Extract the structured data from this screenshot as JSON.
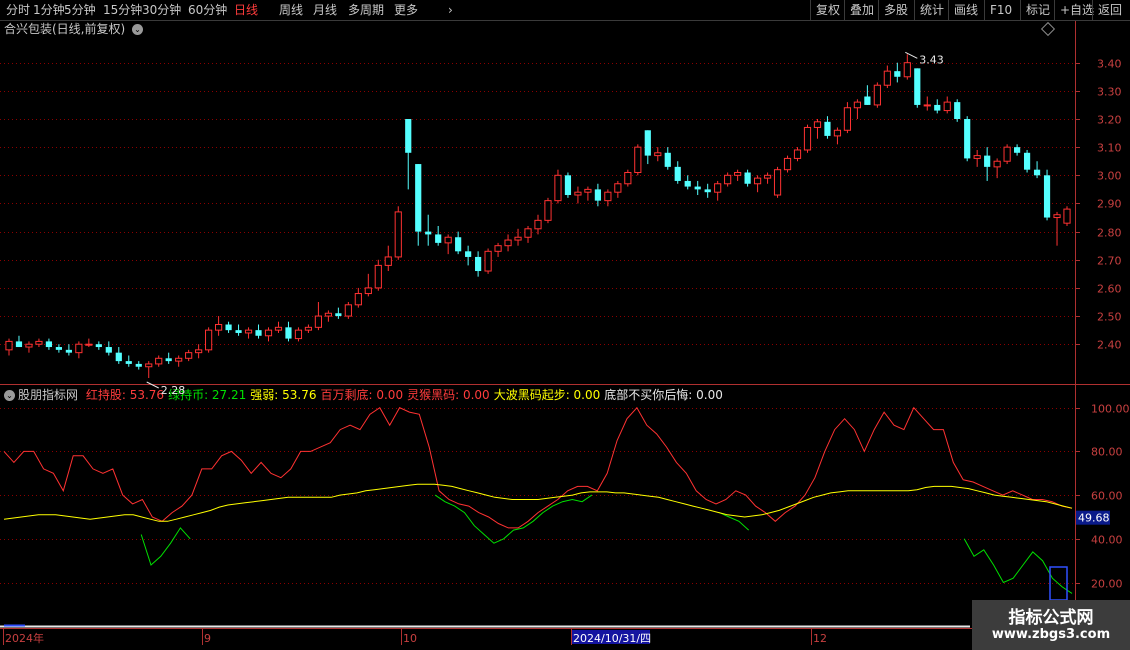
{
  "toolbar": {
    "periods": [
      "分时",
      "1分钟",
      "5分钟",
      "15分钟",
      "30分钟",
      "60分钟",
      "日线",
      "周线",
      "月线",
      "多周期",
      "更多"
    ],
    "active_period": "日线",
    "right_buttons": [
      "复权",
      "叠加",
      "多股",
      "统计",
      "画线",
      "F10",
      "标记",
      "+自选",
      "返回"
    ]
  },
  "main_chart": {
    "title": "合兴包装(日线,前复权)",
    "high_marker": "3.43",
    "low_marker": "2.28"
  },
  "indicator": {
    "name": "股朋指标网",
    "items": [
      {
        "label": "红持股:",
        "value": "53.76",
        "color": "#ff3c3c"
      },
      {
        "label": "绿持币:",
        "value": "27.21",
        "color": "#00e000"
      },
      {
        "label": "强弱:",
        "value": "53.76",
        "color": "#ffff00"
      },
      {
        "label": "百万剩底:",
        "value": "0.00",
        "color": "#ff3c3c"
      },
      {
        "label": "灵猴黑码:",
        "value": "0.00",
        "color": "#ff3c3c"
      },
      {
        "label": "大波黑码起步:",
        "value": "0.00",
        "color": "#ffff00"
      },
      {
        "label": "底部不买你后悔:",
        "value": "0.00",
        "color": "#e8e8e8"
      }
    ],
    "current_value_tag": "49.68"
  },
  "bottom_axis": {
    "labels": [
      "2024年",
      "9",
      "10",
      "2024/10/31/四",
      "12"
    ]
  },
  "watermark": {
    "line1": "指标公式网",
    "line2": "www.zbgs3.com"
  },
  "colors": {
    "up": "#ff3232",
    "down": "#54ffff",
    "grid": "#8b0000",
    "strength": "#ffff00",
    "hold": "#ff3232",
    "cash": "#00e000"
  },
  "chart_data": [
    {
      "type": "candlestick",
      "title": "合兴包装(日线,前复权)",
      "y_ticks": [
        2.4,
        2.5,
        2.6,
        2.7,
        2.8,
        2.9,
        3.0,
        3.1,
        3.2,
        3.3,
        3.4
      ],
      "ylim": [
        2.28,
        3.47
      ],
      "candles": [
        [
          2.38,
          2.42,
          2.36,
          2.41
        ],
        [
          2.41,
          2.43,
          2.39,
          2.39
        ],
        [
          2.39,
          2.41,
          2.37,
          2.4
        ],
        [
          2.4,
          2.42,
          2.39,
          2.41
        ],
        [
          2.41,
          2.42,
          2.38,
          2.39
        ],
        [
          2.39,
          2.4,
          2.37,
          2.38
        ],
        [
          2.38,
          2.4,
          2.36,
          2.37
        ],
        [
          2.37,
          2.41,
          2.35,
          2.4
        ],
        [
          2.4,
          2.42,
          2.39,
          2.4
        ],
        [
          2.4,
          2.41,
          2.38,
          2.39
        ],
        [
          2.39,
          2.41,
          2.36,
          2.37
        ],
        [
          2.37,
          2.39,
          2.33,
          2.34
        ],
        [
          2.34,
          2.36,
          2.32,
          2.33
        ],
        [
          2.33,
          2.34,
          2.31,
          2.32
        ],
        [
          2.32,
          2.34,
          2.28,
          2.33
        ],
        [
          2.33,
          2.36,
          2.32,
          2.35
        ],
        [
          2.35,
          2.37,
          2.33,
          2.34
        ],
        [
          2.34,
          2.36,
          2.32,
          2.35
        ],
        [
          2.35,
          2.38,
          2.34,
          2.37
        ],
        [
          2.37,
          2.4,
          2.35,
          2.38
        ],
        [
          2.38,
          2.46,
          2.37,
          2.45
        ],
        [
          2.45,
          2.5,
          2.43,
          2.47
        ],
        [
          2.47,
          2.48,
          2.44,
          2.45
        ],
        [
          2.45,
          2.47,
          2.43,
          2.44
        ],
        [
          2.44,
          2.46,
          2.42,
          2.45
        ],
        [
          2.45,
          2.47,
          2.42,
          2.43
        ],
        [
          2.43,
          2.46,
          2.41,
          2.45
        ],
        [
          2.45,
          2.48,
          2.44,
          2.46
        ],
        [
          2.46,
          2.48,
          2.41,
          2.42
        ],
        [
          2.42,
          2.46,
          2.41,
          2.45
        ],
        [
          2.45,
          2.47,
          2.44,
          2.46
        ],
        [
          2.46,
          2.55,
          2.45,
          2.5
        ],
        [
          2.5,
          2.52,
          2.48,
          2.51
        ],
        [
          2.51,
          2.53,
          2.49,
          2.5
        ],
        [
          2.5,
          2.55,
          2.49,
          2.54
        ],
        [
          2.54,
          2.6,
          2.53,
          2.58
        ],
        [
          2.58,
          2.65,
          2.57,
          2.6
        ],
        [
          2.6,
          2.7,
          2.59,
          2.68
        ],
        [
          2.68,
          2.75,
          2.66,
          2.71
        ],
        [
          2.71,
          2.89,
          2.7,
          2.87
        ],
        [
          3.2,
          3.2,
          2.95,
          3.08
        ],
        [
          3.04,
          3.04,
          2.75,
          2.8
        ],
        [
          2.8,
          2.86,
          2.75,
          2.79
        ],
        [
          2.79,
          2.82,
          2.75,
          2.76
        ],
        [
          2.76,
          2.79,
          2.72,
          2.78
        ],
        [
          2.78,
          2.8,
          2.72,
          2.73
        ],
        [
          2.73,
          2.75,
          2.68,
          2.71
        ],
        [
          2.71,
          2.73,
          2.64,
          2.66
        ],
        [
          2.66,
          2.74,
          2.65,
          2.73
        ],
        [
          2.73,
          2.76,
          2.71,
          2.75
        ],
        [
          2.75,
          2.79,
          2.73,
          2.77
        ],
        [
          2.77,
          2.81,
          2.75,
          2.78
        ],
        [
          2.78,
          2.82,
          2.76,
          2.81
        ],
        [
          2.81,
          2.86,
          2.79,
          2.84
        ],
        [
          2.84,
          2.92,
          2.83,
          2.91
        ],
        [
          2.91,
          3.02,
          2.9,
          3.0
        ],
        [
          3.0,
          3.01,
          2.92,
          2.93
        ],
        [
          2.93,
          2.96,
          2.9,
          2.94
        ],
        [
          2.94,
          2.96,
          2.91,
          2.95
        ],
        [
          2.95,
          2.97,
          2.89,
          2.91
        ],
        [
          2.91,
          2.95,
          2.89,
          2.94
        ],
        [
          2.94,
          2.98,
          2.92,
          2.97
        ],
        [
          2.97,
          3.02,
          2.96,
          3.01
        ],
        [
          3.01,
          3.11,
          3.0,
          3.1
        ],
        [
          3.16,
          3.16,
          3.04,
          3.07
        ],
        [
          3.07,
          3.1,
          3.05,
          3.08
        ],
        [
          3.08,
          3.1,
          3.02,
          3.03
        ],
        [
          3.03,
          3.05,
          2.97,
          2.98
        ],
        [
          2.98,
          3.0,
          2.95,
          2.96
        ],
        [
          2.96,
          2.98,
          2.93,
          2.95
        ],
        [
          2.95,
          2.97,
          2.92,
          2.94
        ],
        [
          2.94,
          2.98,
          2.91,
          2.97
        ],
        [
          2.97,
          3.01,
          2.96,
          3.0
        ],
        [
          3.0,
          3.02,
          2.98,
          3.01
        ],
        [
          3.01,
          3.02,
          2.96,
          2.97
        ],
        [
          2.97,
          3.0,
          2.94,
          2.99
        ],
        [
          2.99,
          3.01,
          2.97,
          3.0
        ],
        [
          2.93,
          3.03,
          2.92,
          3.02
        ],
        [
          3.02,
          3.07,
          3.01,
          3.06
        ],
        [
          3.06,
          3.1,
          3.05,
          3.09
        ],
        [
          3.09,
          3.18,
          3.08,
          3.17
        ],
        [
          3.17,
          3.2,
          3.13,
          3.19
        ],
        [
          3.19,
          3.21,
          3.13,
          3.14
        ],
        [
          3.14,
          3.17,
          3.11,
          3.16
        ],
        [
          3.16,
          3.26,
          3.15,
          3.24
        ],
        [
          3.24,
          3.27,
          3.2,
          3.26
        ],
        [
          3.28,
          3.32,
          3.25,
          3.25
        ],
        [
          3.25,
          3.33,
          3.24,
          3.32
        ],
        [
          3.32,
          3.39,
          3.31,
          3.37
        ],
        [
          3.37,
          3.4,
          3.33,
          3.35
        ],
        [
          3.35,
          3.43,
          3.34,
          3.4
        ],
        [
          3.38,
          3.38,
          3.24,
          3.25
        ],
        [
          3.25,
          3.28,
          3.23,
          3.25
        ],
        [
          3.25,
          3.27,
          3.22,
          3.23
        ],
        [
          3.23,
          3.28,
          3.22,
          3.26
        ],
        [
          3.26,
          3.27,
          3.19,
          3.2
        ],
        [
          3.2,
          3.21,
          3.05,
          3.06
        ],
        [
          3.06,
          3.09,
          3.03,
          3.07
        ],
        [
          3.07,
          3.1,
          2.98,
          3.03
        ],
        [
          3.03,
          3.06,
          2.99,
          3.05
        ],
        [
          3.05,
          3.11,
          3.04,
          3.1
        ],
        [
          3.1,
          3.11,
          3.07,
          3.08
        ],
        [
          3.08,
          3.09,
          3.01,
          3.02
        ],
        [
          3.02,
          3.05,
          2.99,
          3.0
        ],
        [
          3.0,
          3.02,
          2.84,
          2.85
        ],
        [
          2.85,
          2.87,
          2.75,
          2.86
        ],
        [
          2.83,
          2.89,
          2.82,
          2.88
        ]
      ]
    },
    {
      "type": "line",
      "title": "股朋指标网",
      "y_ticks": [
        20,
        40,
        60,
        80,
        100
      ],
      "ylim": [
        12,
        104
      ],
      "series": [
        {
          "name": "红持股",
          "color": "#ff3232",
          "values": [
            80,
            75,
            80,
            80,
            72,
            70,
            62,
            78,
            78,
            72,
            70,
            72,
            60,
            56,
            58,
            50,
            48,
            52,
            55,
            60,
            72,
            72,
            78,
            80,
            76,
            70,
            75,
            70,
            68,
            72,
            80,
            80,
            82,
            84,
            90,
            92,
            90,
            97,
            100,
            92,
            100,
            98,
            97,
            82,
            62,
            58,
            56,
            55,
            52,
            50,
            47,
            45,
            45,
            48,
            52,
            55,
            58,
            62,
            64,
            64,
            62,
            70,
            85,
            95,
            100,
            92,
            88,
            82,
            75,
            70,
            62,
            58,
            56,
            58,
            62,
            60,
            55,
            52,
            48,
            52,
            55,
            60,
            68,
            80,
            90,
            95,
            90,
            80,
            90,
            98,
            92,
            90,
            100,
            95,
            90,
            90,
            75,
            67,
            66,
            64,
            62,
            60,
            62,
            60,
            58,
            58,
            57,
            55,
            54
          ]
        },
        {
          "name": "绿持币",
          "color": "#00e000",
          "values": [
            null,
            null,
            null,
            null,
            null,
            null,
            null,
            null,
            null,
            null,
            null,
            null,
            null,
            null,
            42,
            28,
            32,
            38,
            45,
            40,
            null,
            null,
            null,
            null,
            null,
            null,
            null,
            null,
            null,
            null,
            null,
            null,
            null,
            null,
            null,
            null,
            null,
            null,
            null,
            null,
            null,
            null,
            null,
            null,
            60,
            57,
            55,
            52,
            46,
            42,
            38,
            40,
            44,
            45,
            48,
            52,
            55,
            57,
            58,
            57,
            60,
            null,
            null,
            null,
            null,
            null,
            null,
            null,
            null,
            null,
            null,
            null,
            null,
            52,
            50,
            48,
            44,
            null,
            null,
            null,
            null,
            null,
            null,
            null,
            null,
            null,
            null,
            null,
            null,
            null,
            null,
            null,
            null,
            null,
            null,
            null,
            null,
            null,
            40,
            32,
            35,
            28,
            20,
            22,
            28,
            34,
            30,
            22,
            18,
            15
          ]
        },
        {
          "name": "强弱",
          "color": "#ffff00",
          "values": [
            49,
            49.5,
            50,
            50.5,
            51,
            51,
            51,
            50.5,
            50,
            49.5,
            49,
            49.5,
            50,
            50.5,
            51,
            51,
            50,
            49,
            48,
            48,
            49,
            50,
            51,
            52,
            53,
            54.5,
            55.5,
            56,
            56.5,
            57,
            57.5,
            58,
            58.5,
            59,
            59,
            59,
            59,
            59,
            59,
            60,
            60.5,
            61,
            62,
            62.5,
            63,
            63.5,
            64,
            64.5,
            65,
            65,
            65,
            64.5,
            64,
            63,
            62,
            61,
            60,
            59,
            58.5,
            58,
            58,
            58,
            58,
            58.5,
            59,
            59.5,
            60,
            61,
            61.5,
            61.5,
            61.5,
            61,
            61,
            60.5,
            60,
            59.5,
            59,
            58,
            57,
            56,
            55,
            54,
            53,
            52,
            51,
            50.5,
            50,
            50.5,
            51,
            52,
            53,
            54.5,
            56,
            57.5,
            59,
            60,
            61,
            61.5,
            62,
            62,
            62,
            62,
            62,
            62,
            62,
            62,
            62.5,
            63.5,
            64,
            64,
            64,
            63.5,
            63,
            62,
            61,
            60,
            59.5,
            59,
            58.5,
            58,
            57.5,
            57,
            56,
            55,
            54
          ]
        }
      ],
      "current_value": 49.68
    }
  ]
}
